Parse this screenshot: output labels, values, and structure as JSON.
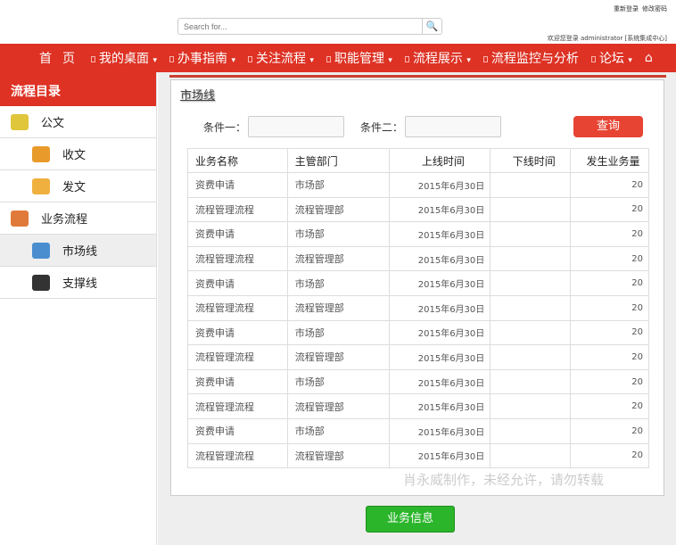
{
  "header": {
    "search_placeholder": "Search for...",
    "links": [
      "重新登录",
      "修改密码"
    ],
    "welcome": "欢迎您登录 administrator [系统集成中心]"
  },
  "nav": [
    {
      "label": "首页",
      "caret": false,
      "icon": false
    },
    {
      "label": "我的桌面",
      "caret": true,
      "icon": true
    },
    {
      "label": "办事指南",
      "caret": true,
      "icon": true
    },
    {
      "label": "关注流程",
      "caret": true,
      "icon": true
    },
    {
      "label": "职能管理",
      "caret": true,
      "icon": true
    },
    {
      "label": "流程展示",
      "caret": true,
      "icon": true
    },
    {
      "label": "流程监控与分析",
      "caret": false,
      "icon": true
    },
    {
      "label": "论坛",
      "caret": true,
      "icon": true
    }
  ],
  "sidebar": {
    "title": "流程目录",
    "items": [
      {
        "label": "公文",
        "level": 0,
        "color": "#e0c63a"
      },
      {
        "label": "收文",
        "level": 1,
        "color": "#e89a2a"
      },
      {
        "label": "发文",
        "level": 1,
        "color": "#f0b040"
      },
      {
        "label": "业务流程",
        "level": 0,
        "color": "#e07a3a"
      },
      {
        "label": "市场线",
        "level": 1,
        "color": "#4a8ed0",
        "selected": true
      },
      {
        "label": "支撑线",
        "level": 1,
        "color": "#333"
      }
    ]
  },
  "main": {
    "title": "市场线",
    "cond1": "条件一：",
    "cond2": "条件二：",
    "query": "查询",
    "columns": [
      "业务名称",
      "主管部门",
      "上线时间",
      "下线时间",
      "发生业务量"
    ],
    "rows": [
      [
        "资费申请",
        "市场部",
        "2015年6月30日",
        "",
        "20"
      ],
      [
        "流程管理流程",
        "流程管理部",
        "2015年6月30日",
        "",
        "20"
      ],
      [
        "资费申请",
        "市场部",
        "2015年6月30日",
        "",
        "20"
      ],
      [
        "流程管理流程",
        "流程管理部",
        "2015年6月30日",
        "",
        "20"
      ],
      [
        "资费申请",
        "市场部",
        "2015年6月30日",
        "",
        "20"
      ],
      [
        "流程管理流程",
        "流程管理部",
        "2015年6月30日",
        "",
        "20"
      ],
      [
        "资费申请",
        "市场部",
        "2015年6月30日",
        "",
        "20"
      ],
      [
        "流程管理流程",
        "流程管理部",
        "2015年6月30日",
        "",
        "20"
      ],
      [
        "资费申请",
        "市场部",
        "2015年6月30日",
        "",
        "20"
      ],
      [
        "流程管理流程",
        "流程管理部",
        "2015年6月30日",
        "",
        "20"
      ],
      [
        "资费申请",
        "市场部",
        "2015年6月30日",
        "",
        "20"
      ],
      [
        "流程管理流程",
        "流程管理部",
        "2015年6月30日",
        "",
        "20"
      ]
    ],
    "watermark": "肖永威制作，未经允许，请勿转载",
    "business_button": "业务信息"
  }
}
